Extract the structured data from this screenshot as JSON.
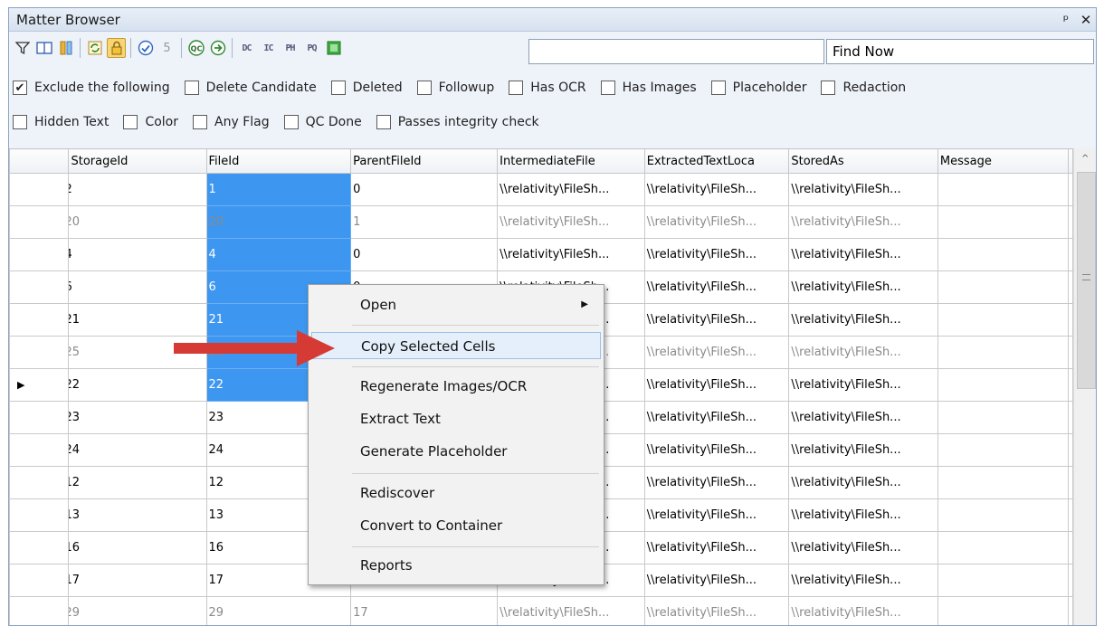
{
  "window": {
    "title": "Matter Browser",
    "pin_glyph": "ᵖ",
    "close_glyph": "✕"
  },
  "toolbar": {
    "search_value": "",
    "find_now_label": "Find Now",
    "icons": [
      "filter-icon",
      "book-icon",
      "columns-icon",
      "refresh-icon",
      "lock-icon",
      "check-icon",
      "flag-icon",
      "qc-icon",
      "go-icon",
      "gear-dc-icon",
      "gear-ic-icon",
      "gear-ph-icon",
      "gear-pq-icon",
      "green-box-icon"
    ],
    "gear_labels": {
      "dc": "DC",
      "ic": "IC",
      "ph": "PH",
      "pq": "PQ"
    },
    "number_label": "5",
    "qc_label": "QC"
  },
  "filters": {
    "row1": [
      {
        "label": "Exclude the following",
        "checked": true
      },
      {
        "label": "Delete Candidate",
        "checked": false
      },
      {
        "label": "Deleted",
        "checked": false
      },
      {
        "label": "Followup",
        "checked": false
      },
      {
        "label": "Has OCR",
        "checked": false
      },
      {
        "label": "Has Images",
        "checked": false
      },
      {
        "label": "Placeholder",
        "checked": false
      },
      {
        "label": "Redaction",
        "checked": false
      }
    ],
    "row2": [
      {
        "label": "Hidden Text",
        "checked": false
      },
      {
        "label": "Color",
        "checked": false
      },
      {
        "label": "Any Flag",
        "checked": false
      },
      {
        "label": "QC Done",
        "checked": false
      },
      {
        "label": "Passes integrity check",
        "checked": false
      }
    ]
  },
  "grid": {
    "columns": [
      "StorageId",
      "FileId",
      "ParentFileId",
      "IntermediateFile",
      "ExtractedTextLoca",
      "StoredAs",
      "Message"
    ],
    "rows": [
      {
        "storage": "2",
        "file": "1",
        "parent": "0",
        "inter": "\\\\relativity\\FileSh...",
        "ext": "\\\\relativity\\FileSh...",
        "stored": "\\\\relativity\\FileSh...",
        "dim": false,
        "current": false,
        "sel": true
      },
      {
        "storage": "20",
        "file": "20",
        "parent": "1",
        "inter": "\\\\relativity\\FileSh...",
        "ext": "\\\\relativity\\FileSh...",
        "stored": "\\\\relativity\\FileSh...",
        "dim": true,
        "current": false,
        "sel": true
      },
      {
        "storage": "4",
        "file": "4",
        "parent": "0",
        "inter": "\\\\relativity\\FileSh...",
        "ext": "\\\\relativity\\FileSh...",
        "stored": "\\\\relativity\\FileSh...",
        "dim": false,
        "current": false,
        "sel": true
      },
      {
        "storage": "6",
        "file": "6",
        "parent": "0",
        "inter": "\\\\relativity\\FileSh...",
        "ext": "\\\\relativity\\FileSh...",
        "stored": "\\\\relativity\\FileSh...",
        "dim": false,
        "current": false,
        "sel": true
      },
      {
        "storage": "21",
        "file": "21",
        "parent": "",
        "inter": "\\\\relativity\\FileSh...",
        "ext": "\\\\relativity\\FileSh...",
        "stored": "\\\\relativity\\FileSh...",
        "dim": false,
        "current": false,
        "sel": true
      },
      {
        "storage": "25",
        "file": "25",
        "parent": "",
        "inter": "\\\\relativity\\FileSh...",
        "ext": "\\\\relativity\\FileSh...",
        "stored": "\\\\relativity\\FileSh...",
        "dim": true,
        "current": false,
        "sel": true
      },
      {
        "storage": "22",
        "file": "22",
        "parent": "",
        "inter": "\\\\relativity\\FileSh...",
        "ext": "\\\\relativity\\FileSh...",
        "stored": "\\\\relativity\\FileSh...",
        "dim": false,
        "current": true,
        "sel": true
      },
      {
        "storage": "23",
        "file": "23",
        "parent": "",
        "inter": "\\\\relativity\\FileSh...",
        "ext": "\\\\relativity\\FileSh...",
        "stored": "\\\\relativity\\FileSh...",
        "dim": false,
        "current": false,
        "sel": false
      },
      {
        "storage": "24",
        "file": "24",
        "parent": "",
        "inter": "\\\\relativity\\FileSh...",
        "ext": "\\\\relativity\\FileSh...",
        "stored": "\\\\relativity\\FileSh...",
        "dim": false,
        "current": false,
        "sel": false
      },
      {
        "storage": "12",
        "file": "12",
        "parent": "",
        "inter": "\\\\relativity\\FileSh...",
        "ext": "\\\\relativity\\FileSh...",
        "stored": "\\\\relativity\\FileSh...",
        "dim": false,
        "current": false,
        "sel": false
      },
      {
        "storage": "13",
        "file": "13",
        "parent": "",
        "inter": "\\\\relativity\\FileSh...",
        "ext": "\\\\relativity\\FileSh...",
        "stored": "\\\\relativity\\FileSh...",
        "dim": false,
        "current": false,
        "sel": false
      },
      {
        "storage": "16",
        "file": "16",
        "parent": "",
        "inter": "\\\\relativity\\FileSh...",
        "ext": "\\\\relativity\\FileSh...",
        "stored": "\\\\relativity\\FileSh...",
        "dim": false,
        "current": false,
        "sel": false
      },
      {
        "storage": "17",
        "file": "17",
        "parent": "",
        "inter": "\\\\relativity\\FileSh...",
        "ext": "\\\\relativity\\FileSh...",
        "stored": "\\\\relativity\\FileSh...",
        "dim": false,
        "current": false,
        "sel": false
      },
      {
        "storage": "29",
        "file": "29",
        "parent": "17",
        "inter": "\\\\relativity\\FileSh...",
        "ext": "\\\\relativity\\FileSh...",
        "stored": "\\\\relativity\\FileSh...",
        "dim": true,
        "current": false,
        "sel": false
      }
    ]
  },
  "context_menu": {
    "open": "Open",
    "copy_selected_cells": "Copy Selected Cells",
    "regenerate": "Regenerate Images/OCR",
    "extract_text": "Extract Text",
    "generate_placeholder": "Generate Placeholder",
    "rediscover": "Rediscover",
    "convert_to_container": "Convert to Container",
    "reports": "Reports"
  },
  "colors": {
    "selection": "#3d96ef",
    "arrow": "#d63a34",
    "lock_active": "#f8d675"
  }
}
